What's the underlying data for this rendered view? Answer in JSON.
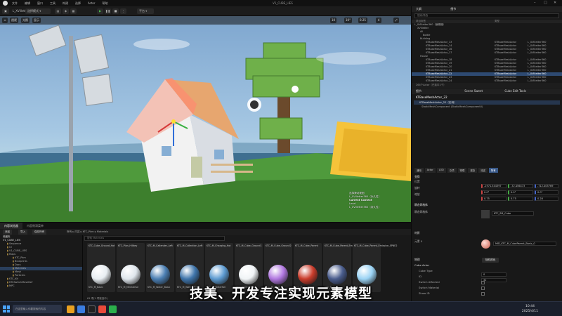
{
  "menubar": {
    "items": [
      "文件",
      "编辑",
      "窗口",
      "工具",
      "构建",
      "选择",
      "Actor",
      "帮助"
    ],
    "window_title": "V1_CUBE_LIES"
  },
  "toolbar": {
    "level_name": "L_XVilletter360",
    "mode_label": "选择模式",
    "platform_label": "平台"
  },
  "viewport": {
    "perspective": "透视",
    "lit": "光照",
    "show": "显示",
    "grid_snap": "10",
    "angle_snap": "10°",
    "scale_snap": "0.25",
    "cam_speed": "4",
    "overlay": {
      "line1": "选择滑动视图",
      "line2": "L_XVilletter360（永久性）",
      "line3": "Current Context",
      "line4": "Level",
      "line5": "L_XVilletter360（持久性）"
    }
  },
  "outliner": {
    "tab1": "大纲",
    "tab2": "细节",
    "search_placeholder": "搜索/筛选",
    "col_label": "项目标签",
    "col_type": "类型",
    "rows": [
      {
        "label": "L_XVilletter360（编辑器）",
        "type": "",
        "extra": ""
      },
      {
        "label": "XVilletter",
        "type": "",
        "extra": ""
      },
      {
        "label": "All",
        "type": "",
        "extra": ""
      },
      {
        "label": "Bottle",
        "type": "",
        "extra": ""
      },
      {
        "label": "Building",
        "type": "",
        "extra": ""
      },
      {
        "label": "KTBaseMeshActor_13",
        "type": "KTBaseMeshActor",
        "extra": "L_XVilletter360"
      },
      {
        "label": "KTBaseMeshActor_14",
        "type": "KTBaseMeshActor",
        "extra": "L_XVilletter360"
      },
      {
        "label": "KTBaseMeshActor_16",
        "type": "KTBaseMeshActor",
        "extra": "L_XVilletter360"
      },
      {
        "label": "KTBaseMeshActor_17",
        "type": "KTBaseMeshActor",
        "extra": "L_XVilletter360"
      },
      {
        "label": "House",
        "type": "",
        "extra": ""
      },
      {
        "label": "KTBaseMeshActor_18",
        "type": "KTBaseMeshActor",
        "extra": "L_XVilletter360"
      },
      {
        "label": "KTBaseMeshActor_19",
        "type": "KTBaseMeshActor",
        "extra": "L_XVilletter360"
      },
      {
        "label": "KTBaseMeshActor_20",
        "type": "KTBaseMeshActor",
        "extra": "L_XVilletter360"
      },
      {
        "label": "KTBaseMeshActor_21",
        "type": "KTBaseMeshActor",
        "extra": "L_XVilletter360"
      },
      {
        "label": "KTBaseMeshActor_22",
        "type": "KTBaseMeshActor",
        "extra": "L_XVilletter360"
      },
      {
        "label": "KTBaseMeshActor_23",
        "type": "KTBaseMeshActor",
        "extra": "L_XVilletter360"
      },
      {
        "label": "KTBaseMeshActor_24",
        "type": "KTBaseMeshActor",
        "extra": "L_XVilletter360"
      }
    ],
    "selected_index": 14,
    "count_text": "264个Actor（已选中1个）"
  },
  "details": {
    "tabs": [
      "细节",
      "Scene Sweet",
      "Cube Edit Tools"
    ],
    "actor_name": "KTBaseMeshActor_22",
    "component_root": "KTBaseMeshActor_22（实例）",
    "component_child": "StaticMeshComponent (StaticMeshComponent0)",
    "filter_tabs": [
      "通用",
      "Actor",
      "LOD",
      "杂项",
      "物理",
      "渲染",
      "流送",
      "所有"
    ],
    "transform_label": "变换",
    "location_label": "位置",
    "rotation_label": "旋转",
    "scale_label": "缩放",
    "location": [
      "-1971.544397",
      "-72.456473",
      "-712.405769"
    ],
    "rotation": [
      "0.0°",
      "0.0°",
      "0.0°"
    ],
    "scale": [
      "0.75",
      "0.75",
      "0.28"
    ],
    "static_mesh_section": "静态网格体",
    "static_mesh_label": "静态网格体",
    "static_mesh_value": "KTC_SM_Cube",
    "materials_section": "材质",
    "element_label": "元素 0",
    "material_value": "MID_KTC_M_CubeParent_Basic_0",
    "physics_section": "物理",
    "collision_section": "碰撞",
    "cube_section": "Cube Actor",
    "cube_type_label": "Cube Type",
    "cube_type_value": "0",
    "id_label": "ID",
    "id_value": "32",
    "switch_affected": "Switch Affected",
    "switch_material": "Switch Material",
    "show_ID": "Show ID",
    "random_button": "随机颜色"
  },
  "content_browser": {
    "tab1": "内容浏览器",
    "tab2": "内容侧滑菜单",
    "add_label": "添加",
    "import_label": "导入",
    "save_all_label": "保存所有",
    "path": [
      "所有",
      "内容",
      "KTC_Pkm",
      "Materials"
    ],
    "search_placeholder": "搜索 Materials",
    "favorites": "收藏夹",
    "root": "V1_CUBE_LIES",
    "tree": [
      "Sequence",
      "UI",
      "V1_CUBE_LIES",
      "Maps",
      "KTC_Pkm",
      "Blueprints",
      "Docs",
      "Materials",
      "Mesh",
      "Particles",
      "KTC_Kit",
      "KTCSwitchMeshDef",
      "MPC"
    ],
    "tree_selected_index": 7,
    "status": "61 项(1 项被选中)",
    "assets": [
      {
        "label": "KTC_Cube_Ground_Hot",
        "cap": "KTC_M_Basic",
        "color": "#e8eef2"
      },
      {
        "label": "KTC_Plan_Hilikey",
        "cap": "KTC_M_Meshdrive",
        "color": "#dfe6ec"
      },
      {
        "label": "KTC_M_Callender_Left",
        "cap": "KTC_M_Water_Basic",
        "color": "#4b7fb3"
      },
      {
        "label": "KTC_M_Collection_Left",
        "cap": "KTC_M_Water_Fresh",
        "color": "#3f75ab"
      },
      {
        "label": "KTC_M_Charging_Hot",
        "cap": "KTC_M_Waterfall",
        "color": "#5d9bd1"
      },
      {
        "label": "KTC_M_Cube_Ground1",
        "cap": "KTC_M_Cloud",
        "color": "#f0f4f6"
      },
      {
        "label": "KTC_M_Cube_Ground2",
        "cap": "KTC_M_Glow",
        "color": "#b178e0"
      },
      {
        "label": "KTC_M_Cube_Parent",
        "cap": "KTC_M_Sun",
        "color": "#ca3d2c"
      },
      {
        "label": "KTC_M_Cube_Parent_Emissive_SPNE",
        "cap": "KTC_M_Star",
        "color": "#4a5d8d"
      },
      {
        "label": "KTC_M_Cube_Parent_Emissive_SPNE2",
        "cap": "KTC_M_Ice",
        "color": "#9bd3f4"
      }
    ]
  },
  "subtitle": "技美、开发专注实现元素模型",
  "taskbar": {
    "search_placeholder": "在这里输入你要搜索的内容",
    "time": "10:44",
    "date": "2025/4/11"
  }
}
